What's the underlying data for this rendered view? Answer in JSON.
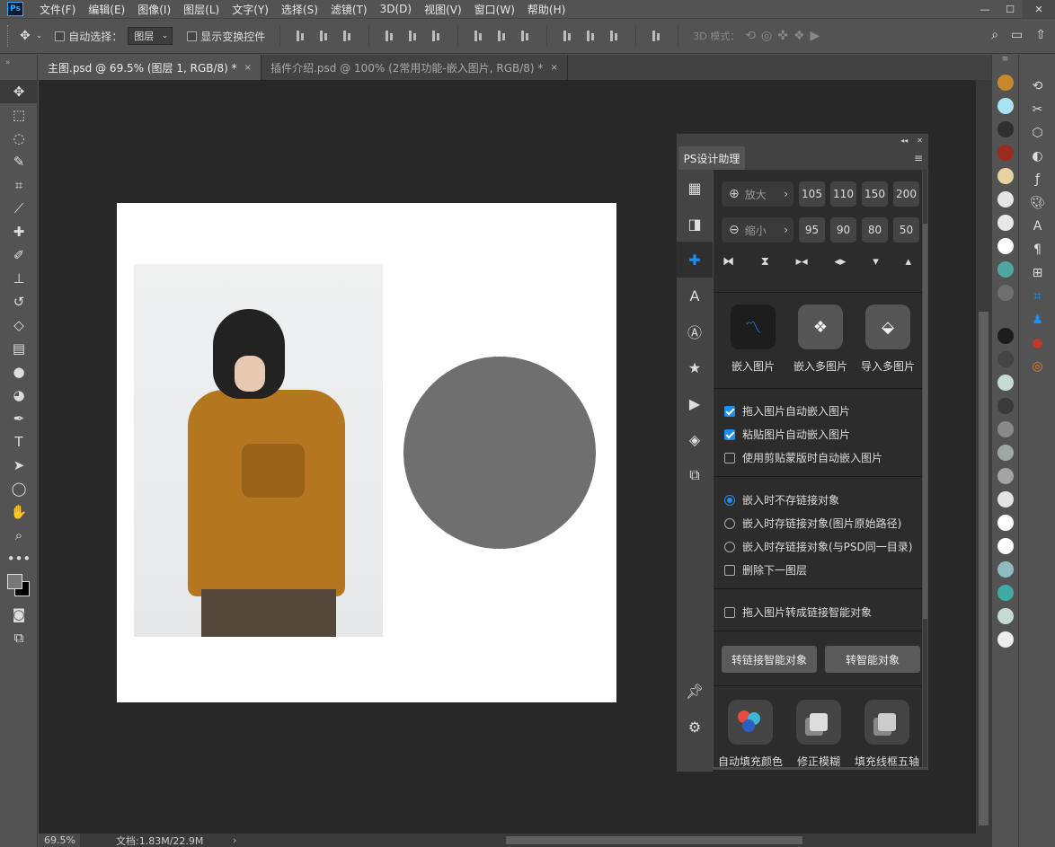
{
  "app": {
    "logo": "Ps"
  },
  "menu": [
    "文件(F)",
    "编辑(E)",
    "图像(I)",
    "图层(L)",
    "文字(Y)",
    "选择(S)",
    "滤镜(T)",
    "3D(D)",
    "视图(V)",
    "窗口(W)",
    "帮助(H)"
  ],
  "window_controls": {
    "minimize": "—",
    "maximize": "☐",
    "close": "✕"
  },
  "options": {
    "auto_select_label": "自动选择：",
    "auto_select_value": "图层",
    "show_transform_label": "显示变换控件",
    "mode_3d_label": "3D 模式："
  },
  "tabs": [
    {
      "label": "主图.psd @ 69.5% (图层 1, RGB/8) *",
      "active": true
    },
    {
      "label": "插件介绍.psd @ 100% (2常用功能-嵌入图片, RGB/8) *",
      "active": false
    }
  ],
  "tab_close": "×",
  "status": {
    "zoom": "69.5%",
    "doc_size": "文档:1.83M/22.9M",
    "arrow": "›"
  },
  "panel": {
    "tab_label": "PS设计助理",
    "zoom_in_label": "放大",
    "zoom_out_label": "缩小",
    "zoom_in_values": [
      "105",
      "110",
      "150",
      "200"
    ],
    "zoom_out_values": [
      "95",
      "90",
      "80",
      "50"
    ],
    "embed_items": [
      {
        "label": "嵌入图片"
      },
      {
        "label": "嵌入多图片"
      },
      {
        "label": "导入多图片"
      }
    ],
    "checkbox_group_1": [
      {
        "label": "拖入图片自动嵌入图片",
        "checked": true
      },
      {
        "label": "粘贴图片自动嵌入图片",
        "checked": true
      },
      {
        "label": "使用剪贴蒙版时自动嵌入图片",
        "checked": false
      }
    ],
    "radio_group": [
      {
        "label": "嵌入时不存链接对象",
        "checked": true
      },
      {
        "label": "嵌入时存链接对象(图片原始路径)",
        "checked": false
      },
      {
        "label": "嵌入时存链接对象(与PSD同一目录)",
        "checked": false
      }
    ],
    "delete_next_layer_label": "删除下一图层",
    "smart_link_label": "拖入图片转成链接智能对象",
    "to_linked_smart_button": "转链接智能对象",
    "to_smart_button": "转智能对象",
    "tools": [
      {
        "label": "自动填充颜色"
      },
      {
        "label": "修正模糊"
      },
      {
        "label": "填充线框五轴"
      }
    ]
  },
  "colors": {
    "accent": "#1e8ef5",
    "sweater": "#b4761f",
    "circle": "#6f6f6f",
    "swatches": [
      "#c8892c",
      "#a9e4f5",
      "#2f2f2f",
      "#9a2b1f",
      "#e8d3a0",
      "#e6e6e6",
      "#e9e9e9",
      "#ffffff",
      "#4fa6a3",
      "#6f6f6f",
      "#1c1c1c",
      "#444444",
      "#c5dcd6",
      "#3a3a3a",
      "#8a8a8a",
      "#9ea8a5",
      "#a4a4a4",
      "#e3e3e3",
      "#ffffff",
      "#ffffff",
      "#8fbcc3",
      "#3fa9a3",
      "#c5dcd6",
      "#efefef"
    ]
  }
}
